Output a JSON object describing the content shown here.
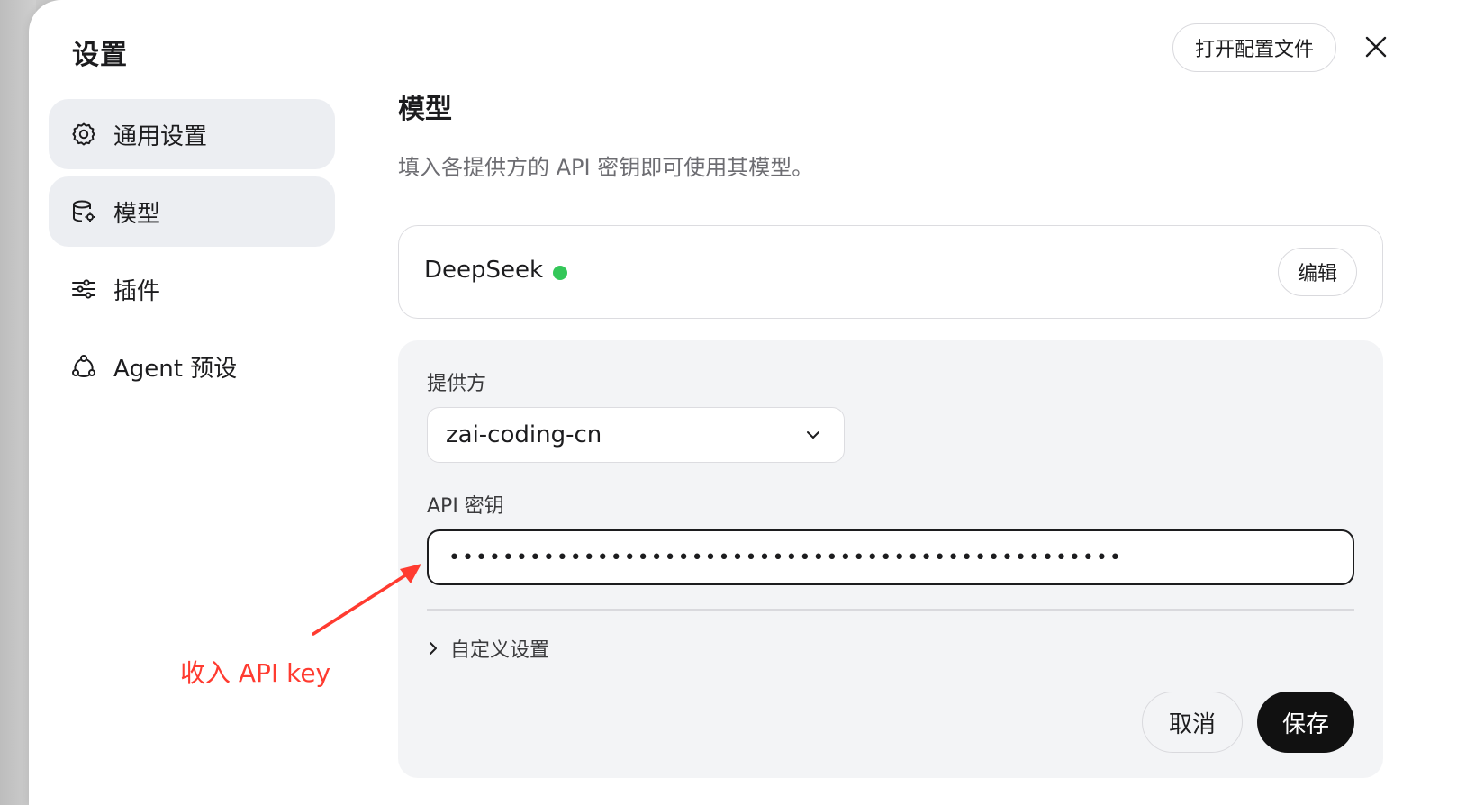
{
  "dialog": {
    "title": "设置",
    "open_config_label": "打开配置文件"
  },
  "sidebar": {
    "items": [
      {
        "label": "通用设置",
        "icon": "gear-icon",
        "active": false
      },
      {
        "label": "模型",
        "icon": "database-gear-icon",
        "active": true
      },
      {
        "label": "插件",
        "icon": "sliders-icon",
        "active": false
      },
      {
        "label": "Agent 预设",
        "icon": "agent-network-icon",
        "active": false
      }
    ]
  },
  "main": {
    "title": "模型",
    "description": "填入各提供方的 API 密钥即可使用其模型。",
    "provider_card": {
      "name": "DeepSeek",
      "status_color": "#34c759",
      "edit_label": "编辑"
    },
    "form": {
      "provider_label": "提供方",
      "provider_value": "zai-coding-cn",
      "api_key_label": "API 密钥",
      "api_key_value": "••••••••••••••••••••••••••••••••••••••••••••••••••",
      "custom_settings_label": "自定义设置",
      "cancel_label": "取消",
      "save_label": "保存"
    }
  },
  "annotation": {
    "text": "收入 API key",
    "color": "#ff3b30"
  }
}
